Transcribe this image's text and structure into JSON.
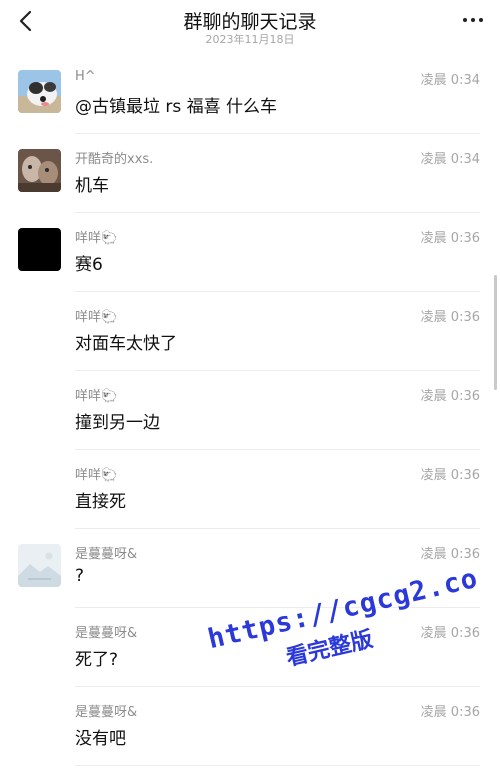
{
  "header": {
    "title": "群聊的聊天记录",
    "subtitle": "2023年11月18日",
    "back_icon": "chevron-left-icon",
    "more_icon": "more-dots-icon"
  },
  "messages": [
    {
      "sender": "H^",
      "time": "凌晨 0:34",
      "text": "@古镇最垃 rs 福喜 什么车",
      "avatar": "dog"
    },
    {
      "sender": "开酷奇的xxs.",
      "time": "凌晨 0:34",
      "text": "机车",
      "avatar": "photo"
    },
    {
      "sender": "咩咩🐑",
      "time": "凌晨 0:36",
      "text": "赛6",
      "avatar": "black"
    },
    {
      "sender": "咩咩🐑",
      "time": "凌晨 0:36",
      "text": "对面车太快了",
      "avatar": ""
    },
    {
      "sender": "咩咩🐑",
      "time": "凌晨 0:36",
      "text": "撞到另一边",
      "avatar": ""
    },
    {
      "sender": "咩咩🐑",
      "time": "凌晨 0:36",
      "text": "直接死",
      "avatar": ""
    },
    {
      "sender": "是蔓蔓呀&",
      "time": "凌晨 0:36",
      "text": "?",
      "avatar": "placeholder"
    },
    {
      "sender": "是蔓蔓呀&",
      "time": "凌晨 0:36",
      "text": "死了?",
      "avatar": ""
    },
    {
      "sender": "是蔓蔓呀&",
      "time": "凌晨 0:36",
      "text": "没有吧",
      "avatar": ""
    }
  ],
  "watermark": {
    "url": "https://cgcg2.co",
    "label": "看完整版",
    "color": "#2b39d8"
  }
}
